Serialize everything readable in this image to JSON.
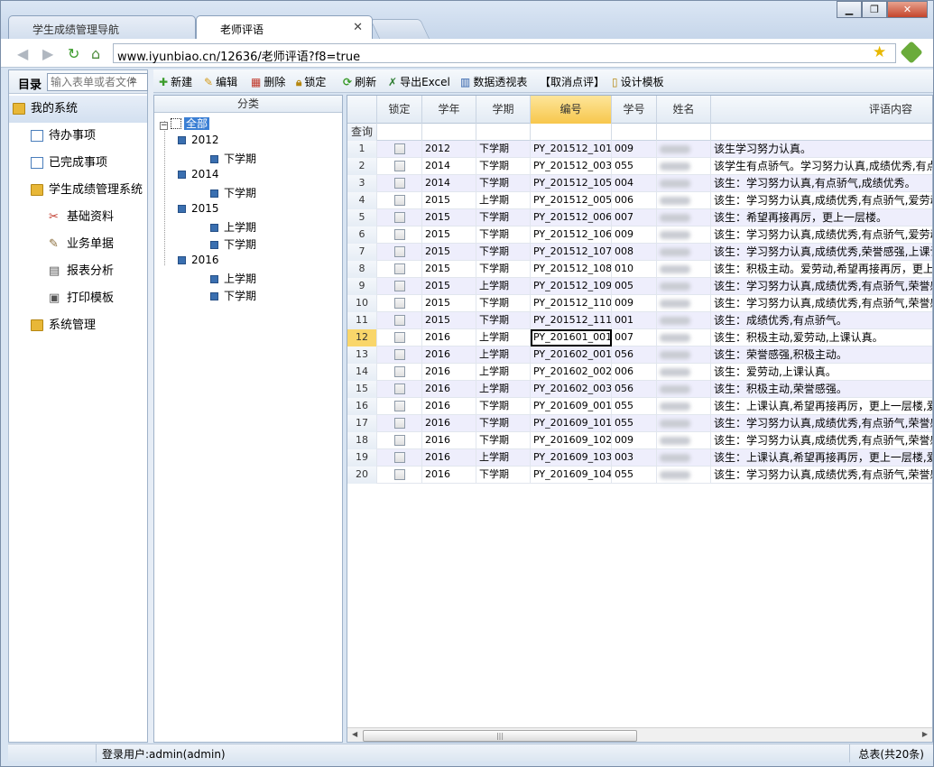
{
  "browser": {
    "tabs": [
      {
        "label": "学生成绩管理导航"
      },
      {
        "label": "老师评语"
      }
    ],
    "url": "www.iyunbiao.cn/12636/老师评语?f8=true"
  },
  "sidebar": {
    "title": "目录",
    "search_placeholder": "输入表单或者文件",
    "items": [
      {
        "label": "我的系统"
      },
      {
        "label": "待办事项"
      },
      {
        "label": "已完成事项"
      },
      {
        "label": "学生成绩管理系统"
      },
      {
        "label": "基础资料"
      },
      {
        "label": "业务单据"
      },
      {
        "label": "报表分析"
      },
      {
        "label": "打印模板"
      },
      {
        "label": "系统管理"
      }
    ]
  },
  "toolbar": {
    "new": "新建",
    "edit": "编辑",
    "delete": "删除",
    "lock": "锁定",
    "refresh": "刷新",
    "export": "导出Excel",
    "pivot": "数据透视表",
    "cancel_review": "【取消点评】",
    "design": "设计模板"
  },
  "category": {
    "header": "分类",
    "root": "全部",
    "years": [
      {
        "year": "2012",
        "terms": [
          "下学期"
        ]
      },
      {
        "year": "2014",
        "terms": [
          "下学期"
        ]
      },
      {
        "year": "2015",
        "terms": [
          "上学期",
          "下学期"
        ]
      },
      {
        "year": "2016",
        "terms": [
          "上学期",
          "下学期"
        ]
      }
    ]
  },
  "grid": {
    "columns": [
      "锁定",
      "学年",
      "学期",
      "编号",
      "学号",
      "姓名",
      "评语内容"
    ],
    "query_label": "查询",
    "current_row": 12,
    "rows": [
      {
        "n": "1",
        "year": "2012",
        "term": "下学期",
        "code": "PY_201512_101",
        "sid": "009",
        "comment": "该生学习努力认真。"
      },
      {
        "n": "2",
        "year": "2014",
        "term": "下学期",
        "code": "PY_201512_003",
        "sid": "055",
        "comment": "该学生有点骄气。学习努力认真,成绩优秀,有点骄气"
      },
      {
        "n": "3",
        "year": "2014",
        "term": "下学期",
        "code": "PY_201512_105",
        "sid": "004",
        "comment": "该生：学习努力认真,有点骄气,成绩优秀。"
      },
      {
        "n": "4",
        "year": "2015",
        "term": "上学期",
        "code": "PY_201512_005",
        "sid": "006",
        "comment": "该生：学习努力认真,成绩优秀,有点骄气,爱劳动。"
      },
      {
        "n": "5",
        "year": "2015",
        "term": "下学期",
        "code": "PY_201512_006",
        "sid": "007",
        "comment": "该生：希望再接再厉，更上一层楼。"
      },
      {
        "n": "6",
        "year": "2015",
        "term": "下学期",
        "code": "PY_201512_106",
        "sid": "009",
        "comment": "该生：学习努力认真,成绩优秀,有点骄气,爱劳动。"
      },
      {
        "n": "7",
        "year": "2015",
        "term": "下学期",
        "code": "PY_201512_107",
        "sid": "008",
        "comment": "该生：学习努力认真,成绩优秀,荣誉感强,上课认真。"
      },
      {
        "n": "8",
        "year": "2015",
        "term": "下学期",
        "code": "PY_201512_108",
        "sid": "010",
        "comment": "该生：积极主动。爱劳动,希望再接再厉，更上一层楼。"
      },
      {
        "n": "9",
        "year": "2015",
        "term": "上学期",
        "code": "PY_201512_109",
        "sid": "005",
        "comment": "该生：学习努力认真,成绩优秀,有点骄气,荣誉感强。"
      },
      {
        "n": "10",
        "year": "2015",
        "term": "下学期",
        "code": "PY_201512_110",
        "sid": "009",
        "comment": "该生：学习努力认真,成绩优秀,有点骄气,荣誉感强。"
      },
      {
        "n": "11",
        "year": "2015",
        "term": "下学期",
        "code": "PY_201512_111",
        "sid": "001",
        "comment": "该生：成绩优秀,有点骄气。"
      },
      {
        "n": "12",
        "year": "2016",
        "term": "上学期",
        "code": "PY_201601_001",
        "sid": "007",
        "comment": "该生：积极主动,爱劳动,上课认真。"
      },
      {
        "n": "13",
        "year": "2016",
        "term": "上学期",
        "code": "PY_201602_001",
        "sid": "056",
        "comment": "该生：荣誉感强,积极主动。"
      },
      {
        "n": "14",
        "year": "2016",
        "term": "上学期",
        "code": "PY_201602_002",
        "sid": "006",
        "comment": "该生：爱劳动,上课认真。"
      },
      {
        "n": "15",
        "year": "2016",
        "term": "上学期",
        "code": "PY_201602_003",
        "sid": "056",
        "comment": "该生：积极主动,荣誉感强。"
      },
      {
        "n": "16",
        "year": "2016",
        "term": "下学期",
        "code": "PY_201609_001",
        "sid": "055",
        "comment": "该生：上课认真,希望再接再厉，更上一层楼,爱劳动。"
      },
      {
        "n": "17",
        "year": "2016",
        "term": "下学期",
        "code": "PY_201609_101",
        "sid": "055",
        "comment": "该生：学习努力认真,成绩优秀,有点骄气,荣誉感强。"
      },
      {
        "n": "18",
        "year": "2016",
        "term": "下学期",
        "code": "PY_201609_102",
        "sid": "009",
        "comment": "该生：学习努力认真,成绩优秀,有点骄气,荣誉感强。"
      },
      {
        "n": "19",
        "year": "2016",
        "term": "上学期",
        "code": "PY_201609_103",
        "sid": "003",
        "comment": "该生：上课认真,希望再接再厉，更上一层楼,爱劳动。"
      },
      {
        "n": "20",
        "year": "2016",
        "term": "下学期",
        "code": "PY_201609_104",
        "sid": "055",
        "comment": "该生：学习努力认真,成绩优秀,有点骄气,荣誉感强。"
      }
    ]
  },
  "status": {
    "user": "登录用户:admin(admin)",
    "summary": "总表(共20条)"
  },
  "colors": {
    "active_header": "#f7c74c",
    "alt_row": "#eeeefc",
    "selected_menu": "#d3e0f0"
  }
}
